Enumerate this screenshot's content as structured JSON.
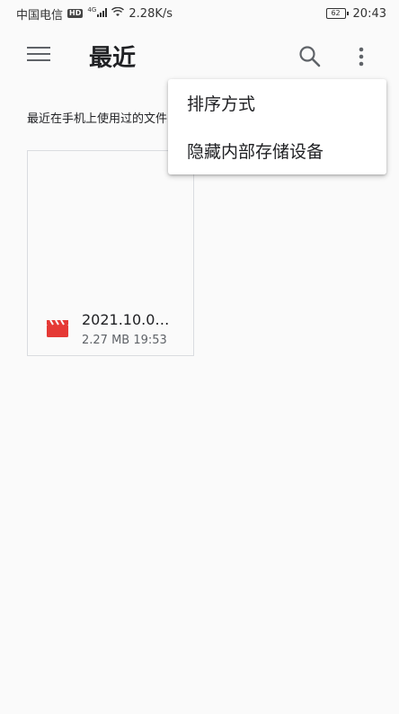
{
  "status_bar": {
    "carrier": "中国电信",
    "hd_badge": "HD",
    "network_type": "4G",
    "net_speed": "2.28K/s",
    "battery_level": "62",
    "time": "20:43"
  },
  "app_bar": {
    "title": "最近",
    "icons": [
      "menu-icon",
      "search-icon",
      "more-vert-icon"
    ]
  },
  "main": {
    "description": "最近在手机上使用过的文件"
  },
  "files": [
    {
      "name": "2021.10.0…",
      "meta": "2.27 MB 19:53",
      "icon": "video-file-icon",
      "icon_color": "#e53935"
    }
  ],
  "dropdown": {
    "items": [
      {
        "label": "排序方式"
      },
      {
        "label": "隐藏内部存储设备"
      }
    ]
  },
  "colors": {
    "background": "#fafafa",
    "accent_red": "#e53935",
    "icon_gray": "#5f6368"
  }
}
